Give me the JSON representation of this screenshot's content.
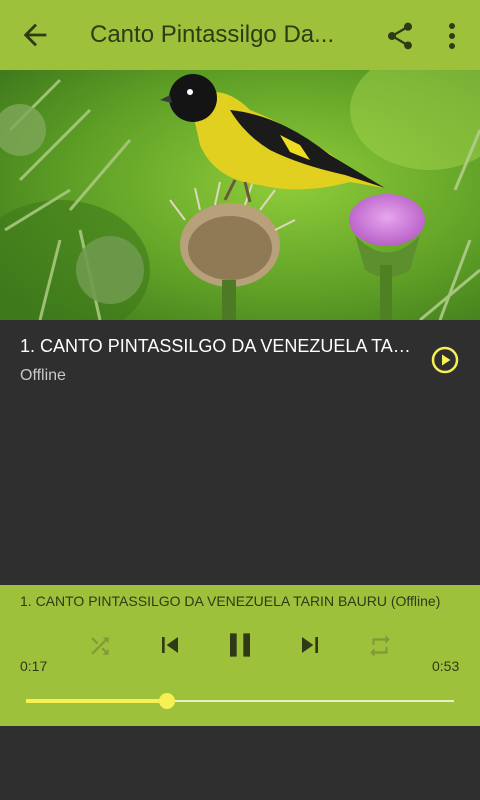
{
  "appbar": {
    "title": "Canto Pintassilgo Da...",
    "back_icon": "arrow-left-icon",
    "share_icon": "share-icon",
    "more_icon": "more-vert-icon",
    "background": "#9ec13c"
  },
  "track": {
    "title": "1. CANTO PINTASSILGO DA VENEZUELA TARI...",
    "status": "Offline",
    "play_icon": "play-circle-icon",
    "accent": "#f6f054"
  },
  "player": {
    "now_playing": "1. CANTO PINTASSILGO DA VENEZUELA TARIN BAURU (Offline)",
    "elapsed": "0:17",
    "duration": "0:53",
    "progress": 0.33,
    "controls": [
      "shuffle-icon",
      "skip-previous-icon",
      "pause-icon",
      "skip-next-icon",
      "repeat-icon"
    ]
  }
}
